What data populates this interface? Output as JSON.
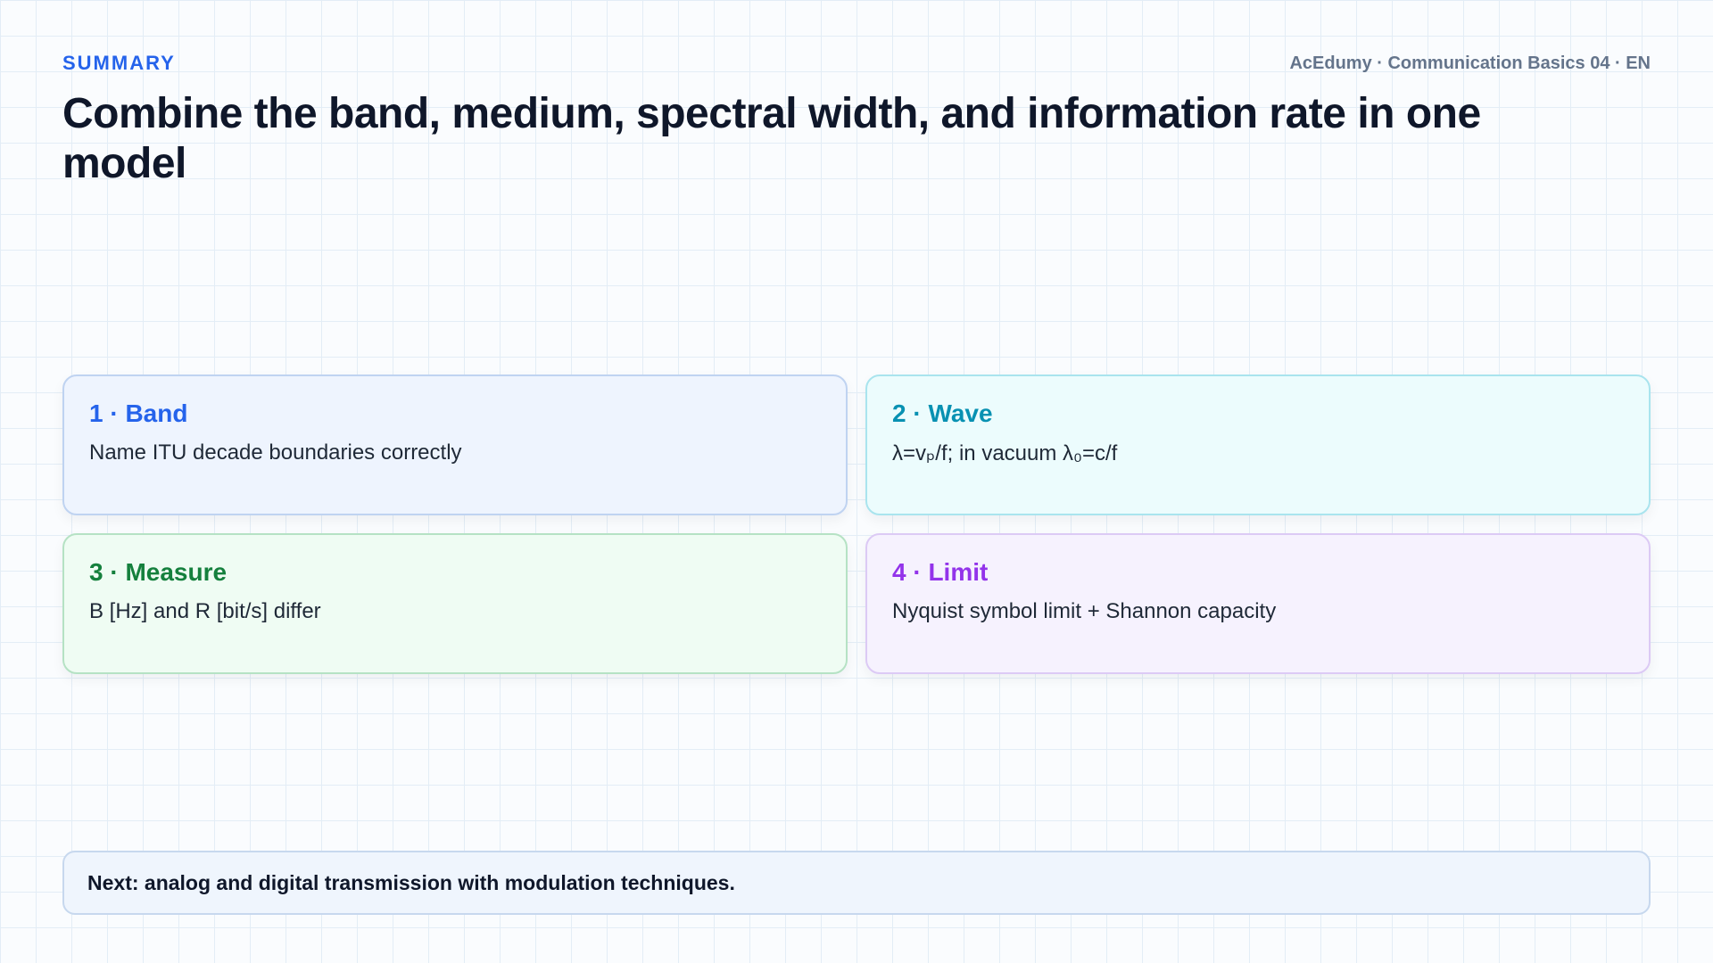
{
  "header": {
    "kicker": "SUMMARY",
    "meta": "AcEdumy · Communication Basics 04 · EN",
    "title": "Combine the band, medium, spectral width, and information rate in one model"
  },
  "cards": [
    {
      "title": "1 · Band",
      "text": "Name ITU decade boundaries correctly",
      "accent": "#2563eb",
      "background": "#eef4fe",
      "border": "#bfd3f1"
    },
    {
      "title": "2 · Wave",
      "text": "λ=vₚ/f; in vacuum λ₀=c/f",
      "accent": "#0891b2",
      "background": "#ecfcfd",
      "border": "#a9e4ee"
    },
    {
      "title": "3 · Measure",
      "text": "B [Hz] and R [bit/s] differ",
      "accent": "#15803d",
      "background": "#effcf3",
      "border": "#b5e2c4"
    },
    {
      "title": "4 · Limit",
      "text": "Nyquist symbol limit + Shannon capacity",
      "accent": "#9333ea",
      "background": "#f6f2fe",
      "border": "#dccaf5"
    }
  ],
  "footer": {
    "text": "Next: analog and digital transmission with modulation techniques."
  }
}
